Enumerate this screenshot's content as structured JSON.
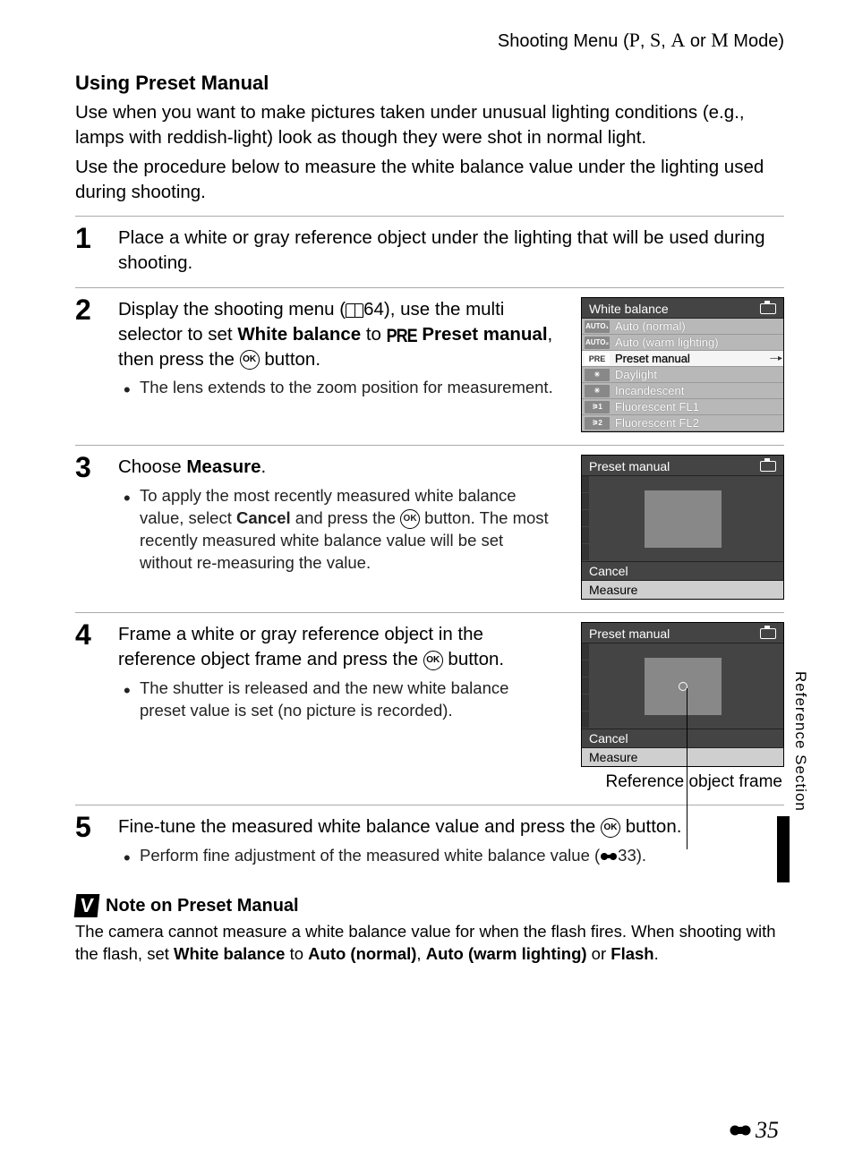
{
  "header": {
    "prefix": "Shooting Menu (",
    "modes": [
      "P",
      "S",
      "A",
      "M"
    ],
    "suffix": " Mode)"
  },
  "section_title": "Using Preset Manual",
  "intro": [
    "Use when you want to make pictures taken under unusual lighting conditions (e.g., lamps with reddish-light) look as though they were shot in normal light.",
    "Use the procedure below to measure the white balance value under the lighting used during shooting."
  ],
  "steps": {
    "s1": {
      "num": "1",
      "head": "Place a white or gray reference object under the lighting that will be used during shooting."
    },
    "s2": {
      "num": "2",
      "head_a": "Display the shooting menu (",
      "head_pageref": "64",
      "head_b": "), use the multi selector to set ",
      "head_bold1": "White balance",
      "head_c": " to ",
      "head_bold2": "Preset manual",
      "head_d": ", then press the ",
      "head_e": " button.",
      "bullet": "The lens extends to the zoom position for measurement.",
      "screen": {
        "title": "White balance",
        "rows": [
          {
            "icon": "AUTO₁",
            "label": "Auto (normal)"
          },
          {
            "icon": "AUTO₂",
            "label": "Auto (warm lighting)"
          },
          {
            "icon": "PRE",
            "label": "Preset manual",
            "selected": true,
            "arrow": true
          },
          {
            "icon": "☀",
            "label": "Daylight"
          },
          {
            "icon": "☀",
            "label": "Incandescent"
          },
          {
            "icon": "⚞1",
            "label": "Fluorescent FL1"
          },
          {
            "icon": "⚞2",
            "label": "Fluorescent FL2"
          }
        ]
      }
    },
    "s3": {
      "num": "3",
      "head_a": "Choose ",
      "head_bold": "Measure",
      "head_b": ".",
      "bullet_a": "To apply the most recently measured white balance value, select ",
      "bullet_bold": "Cancel",
      "bullet_b": " and press the ",
      "bullet_c": " button. The most recently measured white balance value will be set without re-measuring the value.",
      "screen": {
        "title": "Preset manual",
        "opt1": "Cancel",
        "opt2": "Measure"
      }
    },
    "s4": {
      "num": "4",
      "head_a": "Frame a white or gray reference object in the reference object frame and press the ",
      "head_b": " button.",
      "bullet": "The shutter is released and the new white balance preset value is set (no picture is recorded).",
      "screen": {
        "title": "Preset manual",
        "opt1": "Cancel",
        "opt2": "Measure"
      },
      "caption": "Reference object frame"
    },
    "s5": {
      "num": "5",
      "head_a": "Fine-tune the measured white balance value and press the ",
      "head_b": " button.",
      "bullet_a": "Perform fine adjustment of the measured white balance value (",
      "bullet_ref": "33",
      "bullet_b": ")."
    }
  },
  "note": {
    "title": "Note on Preset Manual",
    "text_a": "The camera cannot measure a white balance value for when the flash fires. When shooting with the flash, set ",
    "b1": "White balance",
    "t1": " to ",
    "b2": "Auto (normal)",
    "t2": ", ",
    "b3": "Auto (warm lighting)",
    "t3": " or ",
    "b4": "Flash",
    "t4": "."
  },
  "side_tab": "Reference Section",
  "page_number": "35"
}
